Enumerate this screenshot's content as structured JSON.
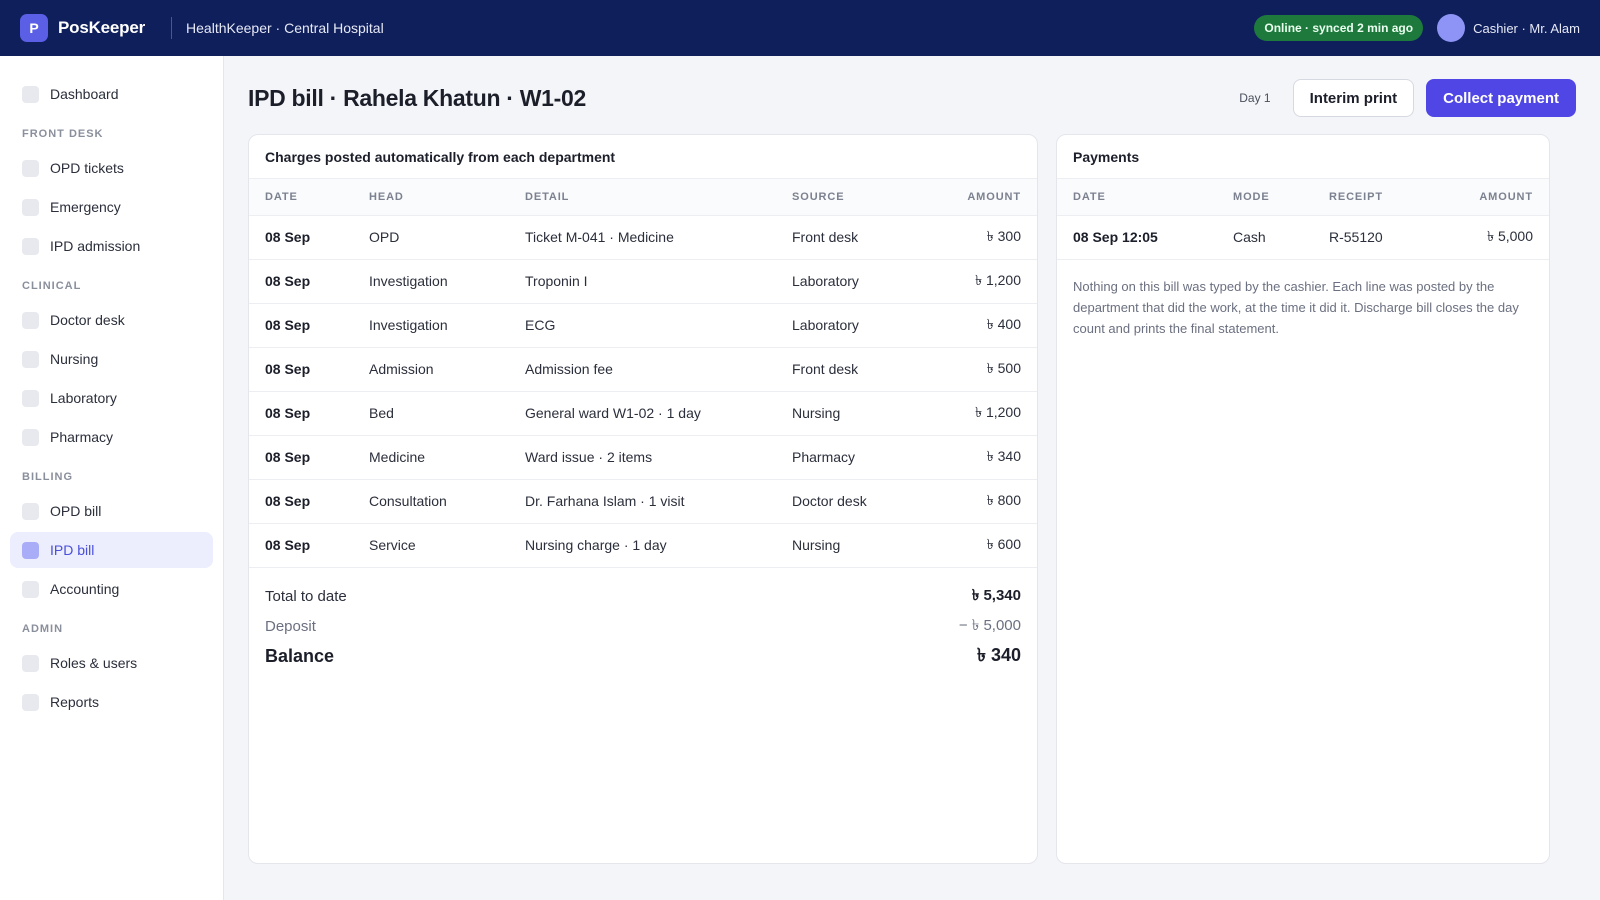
{
  "app": {
    "logo_letter": "P",
    "brand": "PosKeeper",
    "org": "HealthKeeper · Central Hospital",
    "sync_status": "Online · synced 2 min ago",
    "user": "Cashier · Mr. Alam"
  },
  "sidebar": {
    "dashboard": "Dashboard",
    "sections": [
      {
        "title": "FRONT DESK",
        "items": [
          "OPD tickets",
          "Emergency",
          "IPD admission"
        ]
      },
      {
        "title": "CLINICAL",
        "items": [
          "Doctor desk",
          "Nursing",
          "Laboratory",
          "Pharmacy"
        ]
      },
      {
        "title": "BILLING",
        "items": [
          "OPD bill",
          "IPD bill",
          "Accounting"
        ]
      },
      {
        "title": "ADMIN",
        "items": [
          "Roles & users",
          "Reports"
        ]
      }
    ],
    "active_item": "IPD bill"
  },
  "page": {
    "title": "IPD bill · Rahela Khatun · W1-02",
    "day_label": "Day 1",
    "interim_print_label": "Interim print",
    "collect_payment_label": "Collect payment"
  },
  "charges": {
    "title": "Charges posted automatically from each department",
    "headers": [
      "DATE",
      "HEAD",
      "DETAIL",
      "SOURCE",
      "AMOUNT"
    ],
    "rows": [
      [
        "08 Sep",
        "OPD",
        "Ticket M-041 · Medicine",
        "Front desk",
        "৳ 300"
      ],
      [
        "08 Sep",
        "Investigation",
        "Troponin I",
        "Laboratory",
        "৳ 1,200"
      ],
      [
        "08 Sep",
        "Investigation",
        "ECG",
        "Laboratory",
        "৳ 400"
      ],
      [
        "08 Sep",
        "Admission",
        "Admission fee",
        "Front desk",
        "৳ 500"
      ],
      [
        "08 Sep",
        "Bed",
        "General ward W1-02 · 1 day",
        "Nursing",
        "৳ 1,200"
      ],
      [
        "08 Sep",
        "Medicine",
        "Ward issue · 2 items",
        "Pharmacy",
        "৳ 340"
      ],
      [
        "08 Sep",
        "Consultation",
        "Dr. Farhana Islam · 1 visit",
        "Doctor desk",
        "৳ 800"
      ],
      [
        "08 Sep",
        "Service",
        "Nursing charge · 1 day",
        "Nursing",
        "৳ 600"
      ]
    ],
    "totals": {
      "total_label": "Total to date",
      "total_value": "৳ 5,340",
      "deposit_label": "Deposit",
      "deposit_value": "− ৳ 5,000",
      "balance_label": "Balance",
      "balance_value": "৳ 340"
    }
  },
  "payments": {
    "title": "Payments",
    "headers": [
      "DATE",
      "MODE",
      "RECEIPT",
      "AMOUNT"
    ],
    "rows": [
      [
        "08 Sep 12:05",
        "Cash",
        "R-55120",
        "৳ 5,000"
      ]
    ],
    "note": "Nothing on this bill was typed by the cashier. Each line was posted by the department that did the work, at the time it did it. Discharge bill closes the day count and prints the final statement."
  }
}
